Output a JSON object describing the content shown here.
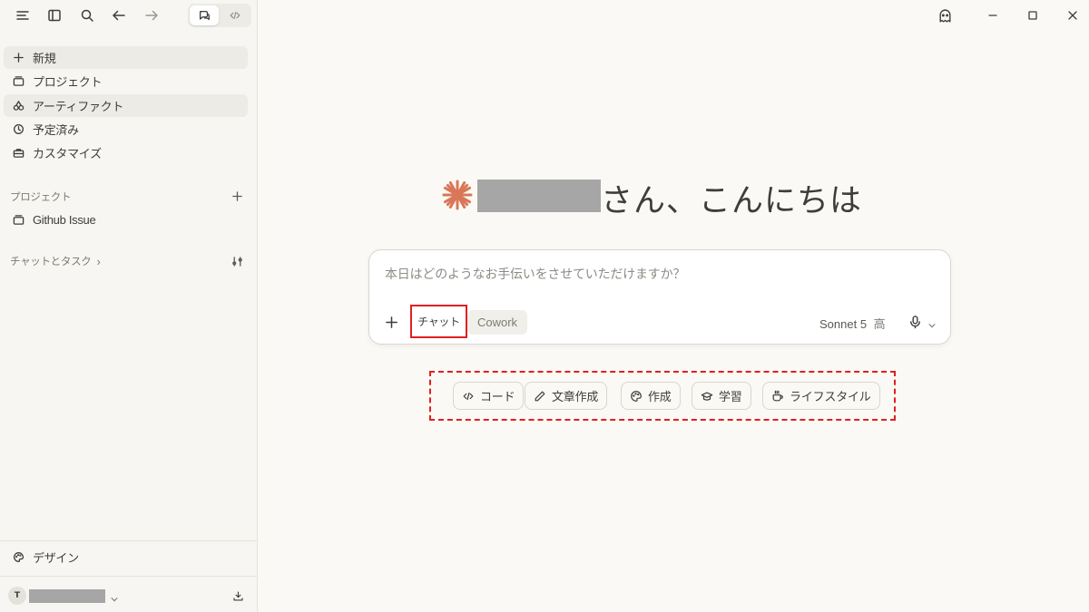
{
  "topbar": {
    "icons": [
      "menu-icon",
      "sidebar-icon",
      "search-icon",
      "back-icon",
      "forward-icon"
    ],
    "mode_toggle": [
      "chat-mode-icon",
      "code-mode-icon"
    ]
  },
  "sidebar": {
    "items": [
      {
        "label": "新規",
        "icon": "plus-icon"
      },
      {
        "label": "プロジェクト",
        "icon": "folder-icon"
      },
      {
        "label": "アーティファクト",
        "icon": "artifacts-icon"
      },
      {
        "label": "予定済み",
        "icon": "clock-icon"
      },
      {
        "label": "カスタマイズ",
        "icon": "briefcase-icon"
      }
    ],
    "projects_label": "プロジェクト",
    "projects": [
      {
        "label": "Github Issue",
        "icon": "folder-icon"
      }
    ],
    "chats_label": "チャットとタスク",
    "chats_chevron": "›",
    "design_label": "デザイン",
    "user_initial": "T"
  },
  "greeting": {
    "suffix": "さん、こんにちは"
  },
  "composer": {
    "placeholder": "本日はどのようなお手伝いをさせていただけますか？",
    "mode_chat": "チャット",
    "mode_cowork": "Cowork",
    "model": "Sonnet 5",
    "effort": "高"
  },
  "chips": [
    {
      "label": "コード",
      "icon": "code-icon"
    },
    {
      "label": "文章作成",
      "icon": "pencil-icon"
    },
    {
      "label": "作成",
      "icon": "palette-icon"
    },
    {
      "label": "学習",
      "icon": "graduation-cap-icon"
    },
    {
      "label": "ライフスタイル",
      "icon": "coffee-icon"
    }
  ],
  "colors": {
    "accent": "#d97757",
    "highlight_box": "#e02020",
    "background": "#faf9f5",
    "sidebar": "#f7f6f2"
  }
}
